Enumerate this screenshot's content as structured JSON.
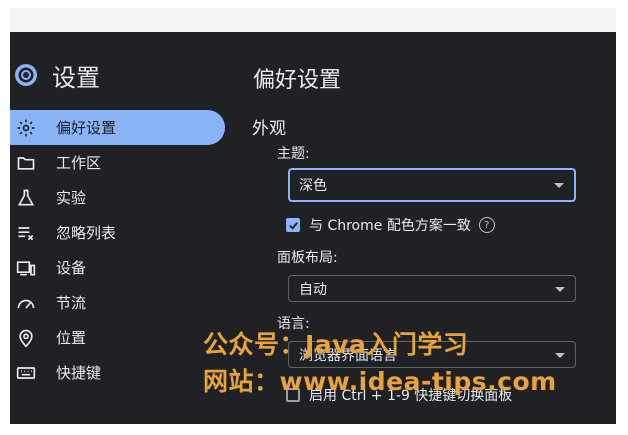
{
  "sidebar": {
    "title": "设置",
    "items": [
      {
        "label": "偏好设置",
        "icon": "gear-icon",
        "active": true
      },
      {
        "label": "工作区",
        "icon": "folder-icon",
        "active": false
      },
      {
        "label": "实验",
        "icon": "flask-icon",
        "active": false
      },
      {
        "label": "忽略列表",
        "icon": "list-remove-icon",
        "active": false
      },
      {
        "label": "设备",
        "icon": "devices-icon",
        "active": false
      },
      {
        "label": "节流",
        "icon": "speedometer-icon",
        "active": false
      },
      {
        "label": "位置",
        "icon": "location-pin-icon",
        "active": false
      },
      {
        "label": "快捷键",
        "icon": "keyboard-icon",
        "active": false
      }
    ]
  },
  "main": {
    "title": "偏好设置",
    "section": "外观",
    "theme": {
      "label": "主题:",
      "value": "深色"
    },
    "match_chrome": {
      "label": "与 Chrome 配色方案一致",
      "checked": true
    },
    "panel_layout": {
      "label": "面板布局:",
      "value": "自动"
    },
    "language": {
      "label": "语言:",
      "value": "浏览器界面语言"
    },
    "ctrl_switch": {
      "label": "启用 Ctrl + 1-9 快捷键切换面板",
      "checked": false
    }
  },
  "watermark": {
    "line1": "公众号：Java入门学习",
    "line2": "网站：www.idea-tips.com"
  },
  "colors": {
    "accent": "#8ab4f8",
    "background": "#202124",
    "watermark": "#e8a33b"
  }
}
